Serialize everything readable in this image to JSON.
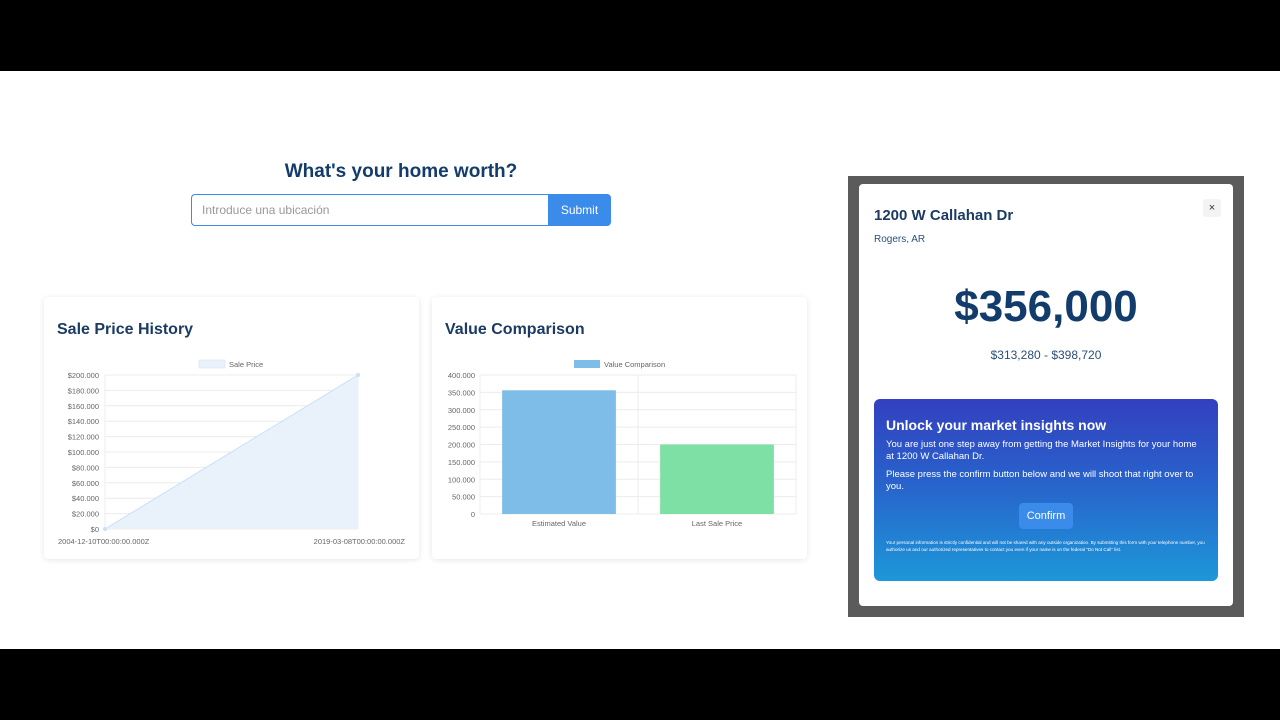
{
  "search": {
    "title": "What's your home worth?",
    "placeholder": "Introduce una ubicación",
    "submit_label": "Submit"
  },
  "history_card": {
    "title": "Sale Price History"
  },
  "compare_card": {
    "title": "Value Comparison"
  },
  "modal": {
    "address": "1200 W Callahan Dr",
    "city": "Rogers, AR",
    "close_label": "×",
    "price": "$356,000",
    "range": "$313,280 - $398,720",
    "promo": {
      "title": "Unlock your market insights now",
      "p1": "You are just one step away from getting the Market Insights for your home at 1200 W Callahan Dr.",
      "p2": "Please press the confirm button below and we will shoot that right over to you.",
      "confirm_label": "Confirm",
      "disclaimer": "Your personal information is strictly confidential and will not be shared with any outside organization. By submitting this form with your telephone number, you authorize us and our authorized representatives to contact you even if your name is on the federal \"Do Not Call\" list."
    }
  },
  "chart_data": [
    {
      "type": "area",
      "title": "Sale Price History",
      "series": [
        {
          "name": "Sale Price",
          "x": [
            "2004-12-10T00:00:00.000Z",
            "2019-03-08T00:00:00.000Z"
          ],
          "values": [
            0,
            200000
          ]
        }
      ],
      "x_tick_labels": [
        "2004-12-10T00:00:00.000Z",
        "2019-03-08T00:00:00.000Z"
      ],
      "y_tick_labels": [
        "$0",
        "$20.000",
        "$40.000",
        "$60.000",
        "$80.000",
        "$100.000",
        "$120.000",
        "$140.000",
        "$160.000",
        "$180.000",
        "$200.000"
      ],
      "ylim": [
        0,
        200000
      ],
      "grid": true,
      "legend": "top-center",
      "colors": {
        "fill": "#e9f2fb",
        "line": "#c9e0f5"
      }
    },
    {
      "type": "bar",
      "title": "Value Comparison",
      "categories": [
        "Estimated Value",
        "Last Sale Price"
      ],
      "series": [
        {
          "name": "Value Comparison",
          "values": [
            356000,
            200000
          ]
        }
      ],
      "y_tick_labels": [
        "0",
        "50.000",
        "100.000",
        "150.000",
        "200.000",
        "250.000",
        "300.000",
        "350.000",
        "400.000"
      ],
      "ylim": [
        0,
        400000
      ],
      "grid": true,
      "legend": "top-center",
      "colors": {
        "bars": [
          "#7dbde8",
          "#7ee0a5"
        ]
      }
    }
  ]
}
